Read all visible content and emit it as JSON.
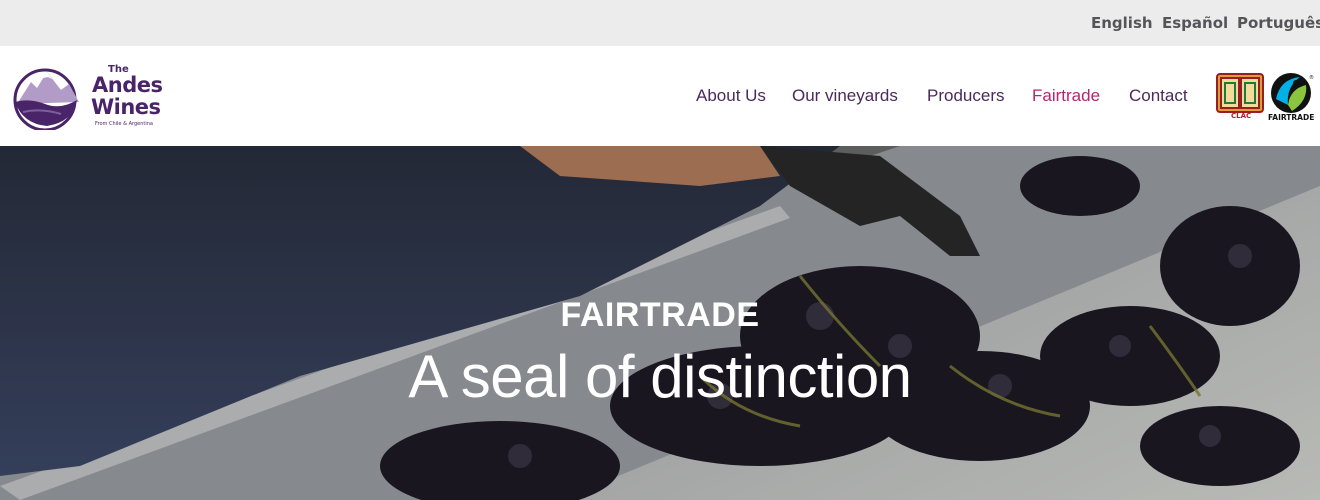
{
  "languages": [
    "English",
    "Español",
    "Português"
  ],
  "logo": {
    "line1": "The",
    "line2": "Andes",
    "line3": "Wines",
    "tagline": "From Chile & Argentina"
  },
  "nav": {
    "items": [
      "About Us",
      "Our vineyards",
      "Producers",
      "Fairtrade",
      "Contact"
    ],
    "active": "Fairtrade"
  },
  "certifications": {
    "clac_label": "CLAC",
    "fairtrade_label": "FAIRTRADE"
  },
  "hero": {
    "eyebrow": "FAIRTRADE",
    "title": "A seal of distinction"
  },
  "colors": {
    "brand_purple": "#4a2468",
    "nav_active": "#b3256e",
    "lang_bar_bg": "#ececec"
  },
  "icons": [
    "mountain-logo-icon",
    "clac-seal-icon",
    "fairtrade-mark-icon"
  ]
}
